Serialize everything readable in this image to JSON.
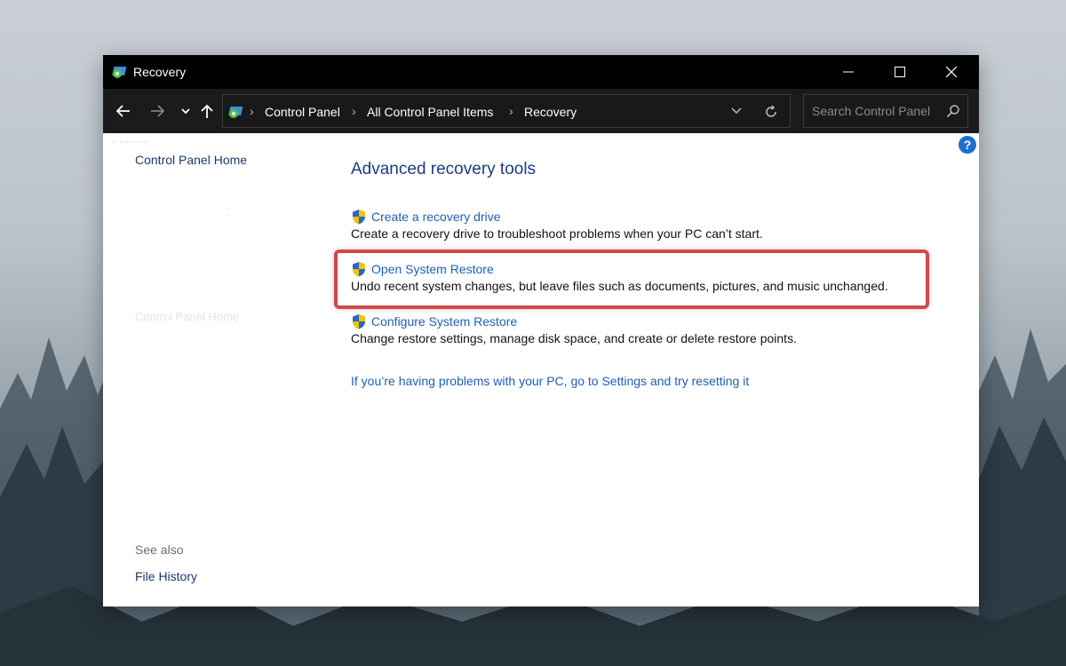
{
  "window": {
    "title": "Recovery"
  },
  "navigation": {
    "breadcrumbs": [
      "Control Panel",
      "All Control Panel Items",
      "Recovery"
    ],
    "search_placeholder": "Search Control Panel"
  },
  "sidebar": {
    "home_link": "Control Panel Home",
    "see_also_label": "See also",
    "see_also_links": [
      "File History"
    ]
  },
  "main": {
    "heading": "Advanced recovery tools",
    "tasks": [
      {
        "title": "Create a recovery drive",
        "description": "Create a recovery drive to troubleshoot problems when your PC can’t start."
      },
      {
        "title": "Open System Restore",
        "description": "Undo recent system changes, but leave files such as documents, pictures, and music unchanged."
      },
      {
        "title": "Configure System Restore",
        "description": "Change restore settings, manage disk space, and create or delete restore points."
      }
    ],
    "reset_link": "If you’re having problems with your PC, go to Settings and try resetting it"
  },
  "colors": {
    "titlebar": "#000000",
    "navbar": "#1b1b1b",
    "link": "#1f5fb6",
    "heading": "#1e3c82",
    "highlight": "#cf4a4a",
    "help": "#1c6fd1"
  },
  "icons": [
    "control-panel-icon",
    "minimize-icon",
    "maximize-icon",
    "close-icon",
    "back-arrow-icon",
    "forward-arrow-icon",
    "chevron-down-icon",
    "up-arrow-icon",
    "refresh-icon",
    "search-icon",
    "help-icon",
    "uac-shield-icon"
  ],
  "highlighted_task": "Open System Restore"
}
